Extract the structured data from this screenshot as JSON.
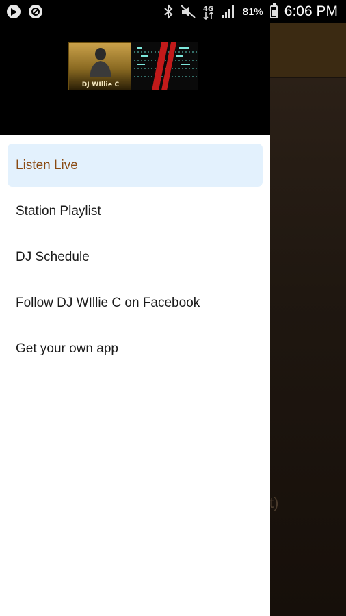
{
  "status_bar": {
    "battery_percent": "81%",
    "time": "6:06 PM",
    "icons": [
      "play-icon",
      "blocked-icon",
      "bluetooth-icon",
      "mute-icon",
      "data-icon",
      "signal-icon",
      "battery-icon"
    ]
  },
  "drawer": {
    "header": {
      "logo_caption": "DJ WIllie C"
    },
    "menu": [
      {
        "label": "Listen Live",
        "active": true
      },
      {
        "label": "Station Playlist",
        "active": false
      },
      {
        "label": "DJ Schedule",
        "active": false
      },
      {
        "label": "Follow DJ WIllie C on Facebook",
        "active": false
      },
      {
        "label": "Get your own app",
        "active": false
      }
    ]
  },
  "background": {
    "hint_text": "t)"
  },
  "colors": {
    "active_text": "#8a4a13",
    "active_bg": "#e3f1fd",
    "header_bg": "#000000"
  }
}
